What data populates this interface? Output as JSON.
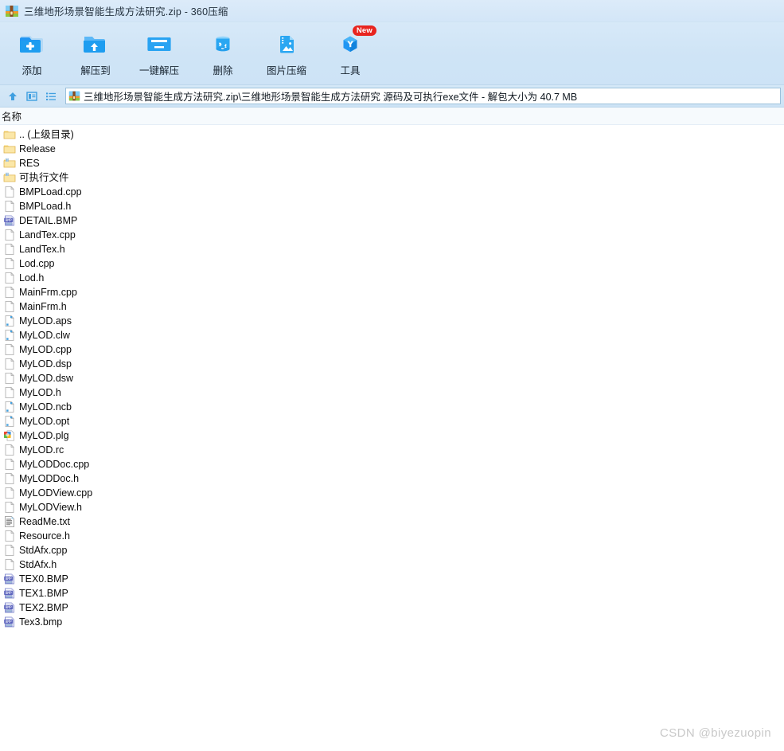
{
  "window": {
    "title": "三维地形场景智能生成方法研究.zip - 360压缩",
    "app_icon": "archive-icon"
  },
  "toolbar": {
    "items": [
      {
        "label": "添加",
        "icon": "folder-add-icon",
        "badge": ""
      },
      {
        "label": "解压到",
        "icon": "folder-extract-to-icon",
        "badge": ""
      },
      {
        "label": "一键解压",
        "icon": "folder-quick-extract-icon",
        "badge": ""
      },
      {
        "label": "删除",
        "icon": "recycle-bin-icon",
        "badge": ""
      },
      {
        "label": "图片压缩",
        "icon": "image-compress-icon",
        "badge": ""
      },
      {
        "label": "工具",
        "icon": "tools-hexagon-icon",
        "badge": "New"
      }
    ]
  },
  "addressbar": {
    "up_icon": "up-arrow-icon",
    "panel_icon": "preview-pane-icon",
    "list_icon": "list-view-icon",
    "path_icon": "archive-icon",
    "path": "三维地形场景智能生成方法研究.zip\\三维地形场景智能生成方法研究 源码及可执行exe文件 - 解包大小为 40.7 MB"
  },
  "columns": {
    "name": "名称"
  },
  "files": [
    {
      "name": ".. (上级目录)",
      "icon": "folder-icon"
    },
    {
      "name": "Release",
      "icon": "folder-icon"
    },
    {
      "name": "RES",
      "icon": "folder-shortcut-icon"
    },
    {
      "name": "可执行文件",
      "icon": "folder-shortcut-icon"
    },
    {
      "name": "BMPLoad.cpp",
      "icon": "file-blank-icon"
    },
    {
      "name": "BMPLoad.h",
      "icon": "file-blank-icon"
    },
    {
      "name": "DETAIL.BMP",
      "icon": "bmp-image-icon"
    },
    {
      "name": "LandTex.cpp",
      "icon": "file-blank-icon"
    },
    {
      "name": "LandTex.h",
      "icon": "file-blank-icon"
    },
    {
      "name": "Lod.cpp",
      "icon": "file-blank-icon"
    },
    {
      "name": "Lod.h",
      "icon": "file-blank-icon"
    },
    {
      "name": "MainFrm.cpp",
      "icon": "file-blank-icon"
    },
    {
      "name": "MainFrm.h",
      "icon": "file-blank-icon"
    },
    {
      "name": "MyLOD.aps",
      "icon": "file-marked-icon"
    },
    {
      "name": "MyLOD.clw",
      "icon": "file-marked-icon"
    },
    {
      "name": "MyLOD.cpp",
      "icon": "file-blank-icon"
    },
    {
      "name": "MyLOD.dsp",
      "icon": "file-blank-icon"
    },
    {
      "name": "MyLOD.dsw",
      "icon": "file-blank-icon"
    },
    {
      "name": "MyLOD.h",
      "icon": "file-blank-icon"
    },
    {
      "name": "MyLOD.ncb",
      "icon": "file-marked-icon"
    },
    {
      "name": "MyLOD.opt",
      "icon": "file-marked-icon"
    },
    {
      "name": "MyLOD.plg",
      "icon": "browser-color-icon"
    },
    {
      "name": "MyLOD.rc",
      "icon": "file-blank-icon"
    },
    {
      "name": "MyLODDoc.cpp",
      "icon": "file-blank-icon"
    },
    {
      "name": "MyLODDoc.h",
      "icon": "file-blank-icon"
    },
    {
      "name": "MyLODView.cpp",
      "icon": "file-blank-icon"
    },
    {
      "name": "MyLODView.h",
      "icon": "file-blank-icon"
    },
    {
      "name": "ReadMe.txt",
      "icon": "text-file-icon"
    },
    {
      "name": "Resource.h",
      "icon": "file-blank-icon"
    },
    {
      "name": "StdAfx.cpp",
      "icon": "file-blank-icon"
    },
    {
      "name": "StdAfx.h",
      "icon": "file-blank-icon"
    },
    {
      "name": "TEX0.BMP",
      "icon": "bmp-image-icon"
    },
    {
      "name": "TEX1.BMP",
      "icon": "bmp-image-icon"
    },
    {
      "name": "TEX2.BMP",
      "icon": "bmp-image-icon"
    },
    {
      "name": "Tex3.bmp",
      "icon": "bmp-image-icon"
    }
  ],
  "watermark": "CSDN @biyezuopin",
  "colors": {
    "chrome_blue": "#d3e6f8",
    "folder_yellow": "#fbe7a8",
    "accent_blue": "#1f9bf0",
    "badge_red": "#e8251f"
  }
}
